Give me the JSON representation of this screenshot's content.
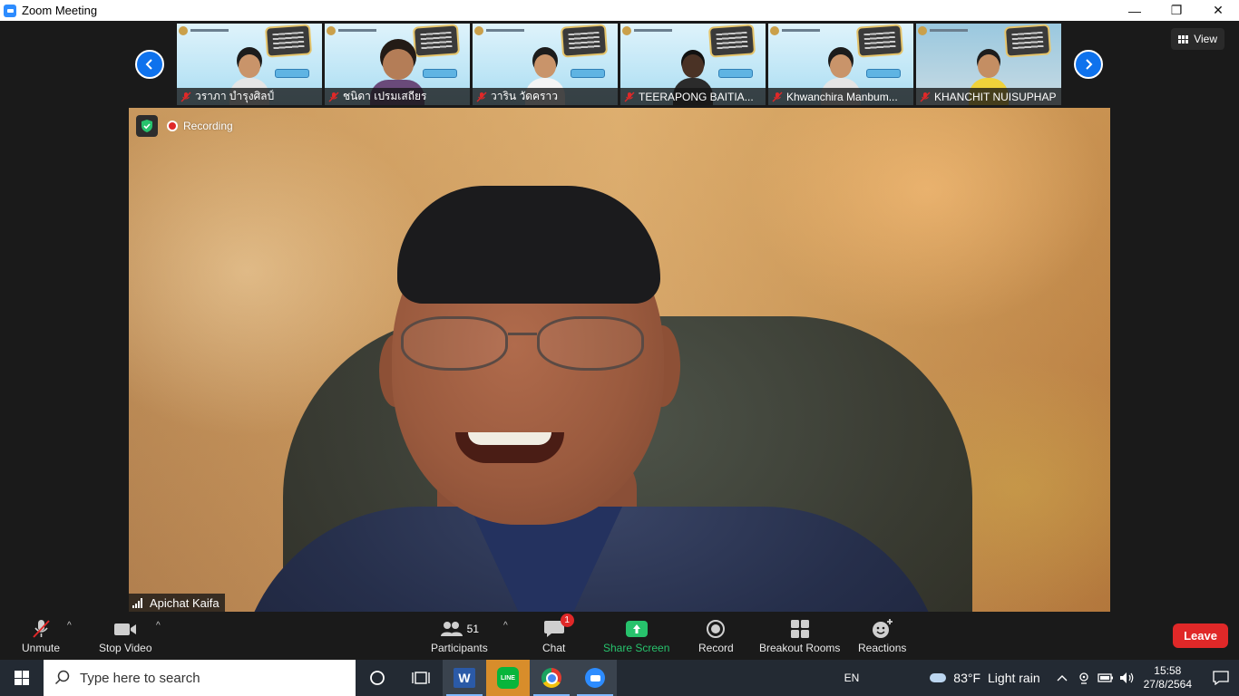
{
  "window": {
    "title": "Zoom Meeting",
    "controls": {
      "minimize": "—",
      "restore": "❐",
      "close": "✕"
    }
  },
  "gallery": {
    "participants": [
      {
        "name": "วราภา บำรุงศิลป์"
      },
      {
        "name": "ชนิดา เปรมเสถียร"
      },
      {
        "name": "วาริน วัดคราว"
      },
      {
        "name": "TEERAPONG  BAITIA..."
      },
      {
        "name": "Khwanchira Manbum..."
      },
      {
        "name": "KHANCHIT NUISUPHAP"
      }
    ],
    "view_label": "View"
  },
  "main_video": {
    "recording_label": "Recording",
    "speaker_name": "Apichat Kaifa"
  },
  "toolbar": {
    "unmute_label": "Unmute",
    "stop_video_label": "Stop Video",
    "participants_label": "Participants",
    "participants_count": "51",
    "chat_label": "Chat",
    "chat_badge": "1",
    "share_label": "Share Screen",
    "record_label": "Record",
    "breakout_label": "Breakout Rooms",
    "reactions_label": "Reactions",
    "leave_label": "Leave",
    "colors": {
      "share": "#27c26c",
      "leave": "#e02828",
      "badge": "#e02828"
    }
  },
  "taskbar": {
    "search_placeholder": "Type here to search",
    "language": "EN",
    "temperature": "83°F",
    "weather": "Light rain",
    "time": "15:58",
    "date": "27/8/2564"
  }
}
